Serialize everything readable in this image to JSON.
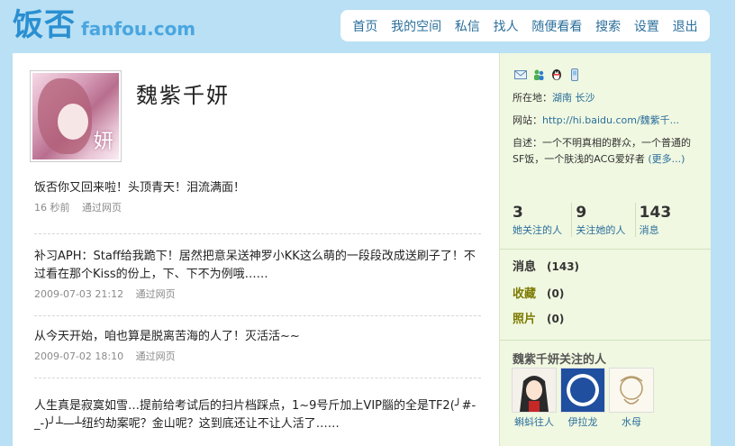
{
  "header": {
    "logo_cn": "饭否",
    "logo_en": "fanfou.com",
    "nav": [
      "首页",
      "我的空间",
      "私信",
      "找人",
      "随便看看",
      "搜索",
      "设置",
      "退出"
    ]
  },
  "profile": {
    "avatar_text": "妍",
    "name": "魏紫千妍"
  },
  "statuses": [
    {
      "text": "饭否你又回来啦！头顶青天！泪流满面！",
      "time": "16 秒前",
      "via": "通过网页"
    },
    {
      "text": "补习APH：Staff给我跪下！居然把意呆送神罗小KK这么萌的一段段改成送刷子了！不过看在那个Kiss的份上，下、下不为例哦……",
      "time": "2009-07-03 21:12",
      "via": "通过网页"
    },
    {
      "text": "从今天开始，咱也算是脱离苦海的人了！灭活活~~",
      "time": "2009-07-02 18:10",
      "via": "通过网页"
    },
    {
      "text": "人生真是寂寞如雪…提前给考试后的扫片档踩点，1~9号斤加上VIP腦的全是TF2(╯#-_-)╯┴—┴纽约劫案呢？金山呢？这到底还让不让人活了……",
      "time": "",
      "via": ""
    }
  ],
  "sidebar": {
    "contact_icons": [
      "mail-icon",
      "users-icon",
      "qq-penguin-icon",
      "mobile-phone-icon"
    ],
    "location_label": "所在地：",
    "location_value": "湖南 长沙",
    "website_label": "网站：",
    "website_value": "http://hi.baidu.com/魏紫千...",
    "bio_label": "自述：",
    "bio_value": "一个不明真相的群众，一个普通的SF饭，一个肤浅的ACG爱好者",
    "bio_more": "(更多...)",
    "stats": [
      {
        "num": "3",
        "label": "她关注的人"
      },
      {
        "num": "9",
        "label": "关注她的人"
      },
      {
        "num": "143",
        "label": "消息"
      }
    ],
    "counters": [
      {
        "label": "消息",
        "num": "(143)"
      },
      {
        "label": "收藏",
        "num": "(0)"
      },
      {
        "label": "照片",
        "num": "(0)"
      }
    ],
    "friends_title": "魏紫千妍关注的人",
    "friends": [
      {
        "name": "蝌蚪往人"
      },
      {
        "name": "伊拉龙"
      },
      {
        "name": "水母"
      }
    ]
  },
  "colors": {
    "page_bg": "#b9e0f4",
    "link": "#2b6f9c",
    "sidebar_bg": "#f0f8e1"
  }
}
